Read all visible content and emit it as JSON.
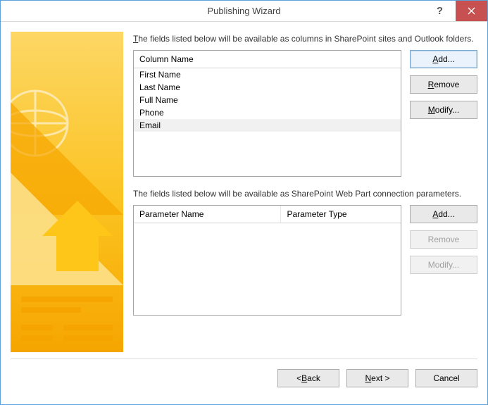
{
  "window": {
    "title": "Publishing Wizard"
  },
  "columns_section": {
    "description_pre": "T",
    "description_post": "he fields listed below will be available as columns in SharePoint sites and Outlook folders.",
    "header": "Column Name",
    "items": [
      "First Name",
      "Last Name",
      "Full Name",
      "Phone",
      "Email"
    ],
    "selected_index": 4,
    "buttons": {
      "add_u": "A",
      "add_rest": "dd...",
      "remove_u": "R",
      "remove_rest": "emove",
      "modify_u": "M",
      "modify_rest": "odify..."
    }
  },
  "params_section": {
    "description": "The fields listed below will be available as SharePoint Web Part connection parameters.",
    "header_name": "Parameter Name",
    "header_type": "Parameter Type",
    "items": [],
    "buttons": {
      "add_u": "A",
      "add_rest": "dd...",
      "remove": "Remove",
      "modify": "Modify..."
    }
  },
  "footer": {
    "back_pre": "< ",
    "back_u": "B",
    "back_rest": "ack",
    "next_u": "N",
    "next_rest": "ext >",
    "cancel": "Cancel"
  }
}
